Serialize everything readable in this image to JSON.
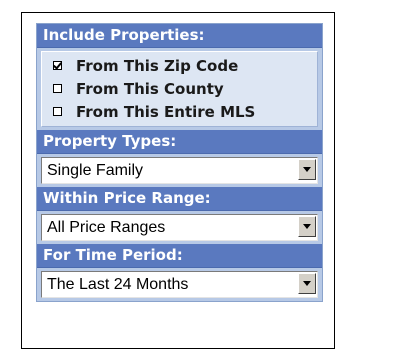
{
  "include_properties": {
    "header": "Include Properties:",
    "options": [
      {
        "label": "From This Zip Code",
        "checked": true
      },
      {
        "label": "From This County",
        "checked": false
      },
      {
        "label": "From This Entire MLS",
        "checked": false
      }
    ]
  },
  "property_types": {
    "header": "Property Types:",
    "selected": "Single Family"
  },
  "price_range": {
    "header": "Within Price Range:",
    "selected": "All Price Ranges"
  },
  "time_period": {
    "header": "For Time Period:",
    "selected": "The Last 24 Months"
  },
  "colors": {
    "header_bg": "#5a79bf",
    "panel_bg": "#b7c9e6",
    "checkbox_area_bg": "#dde6f3"
  },
  "icons": {
    "dropdown": "chevron-down-icon",
    "checkbox": "checkbox-icon"
  }
}
